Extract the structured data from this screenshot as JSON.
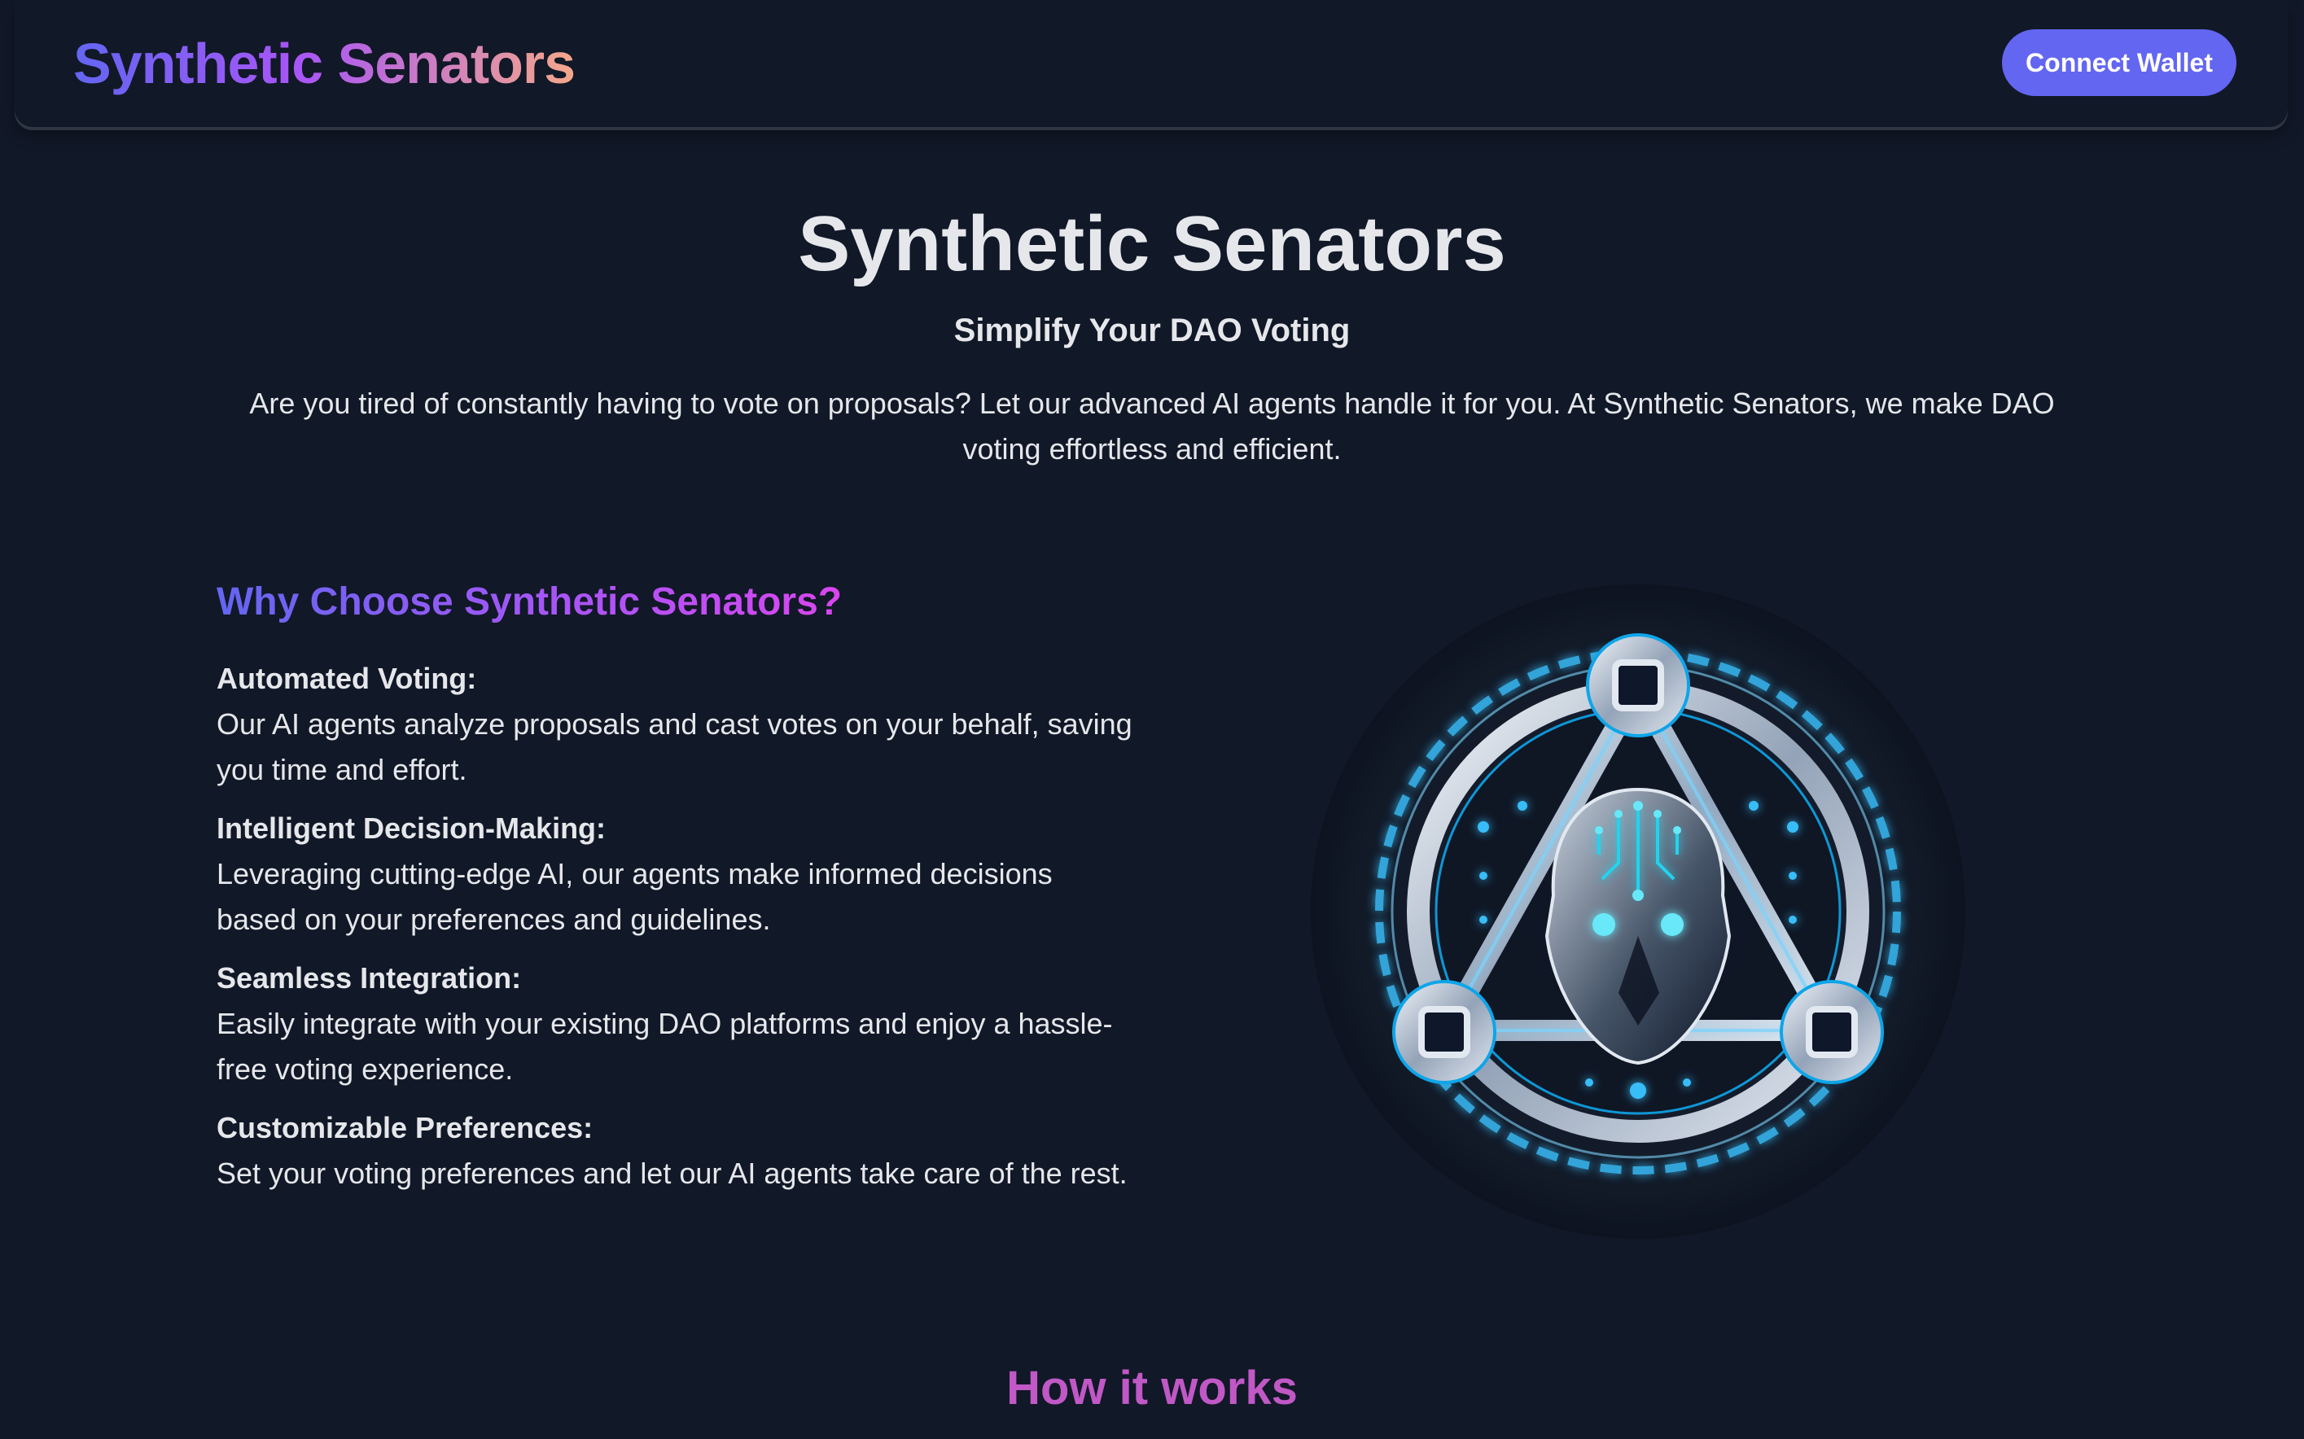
{
  "nav": {
    "brand": "Synthetic Senators",
    "connect_label": "Connect Wallet"
  },
  "hero": {
    "title": "Synthetic Senators",
    "subtitle": "Simplify Your DAO Voting",
    "description": "Are you tired of constantly having to vote on proposals? Let our advanced AI agents handle it for you. At Synthetic Senators, we make DAO voting effortless and efficient."
  },
  "why": {
    "title": "Why Choose Synthetic Senators?",
    "features": [
      {
        "title": "Automated Voting:",
        "desc": "Our AI agents analyze proposals and cast votes on your behalf, saving you time and effort."
      },
      {
        "title": "Intelligent Decision-Making:",
        "desc": "Leveraging cutting-edge AI, our agents make informed decisions based on your preferences and guidelines."
      },
      {
        "title": "Seamless Integration:",
        "desc": "Easily integrate with your existing DAO platforms and enjoy a hassle-free voting experience."
      },
      {
        "title": "Customizable Preferences:",
        "desc": "Set your voting preferences and let our AI agents take care of the rest."
      }
    ]
  },
  "how": {
    "title": "How it works"
  },
  "colors": {
    "background": "#111827",
    "accent": "#6366f1",
    "text": "#e5e7eb",
    "how_title": "#c058c6",
    "logo_glow": "#38bdf8"
  },
  "icons": {
    "logo": "ai-senator-emblem-icon"
  }
}
